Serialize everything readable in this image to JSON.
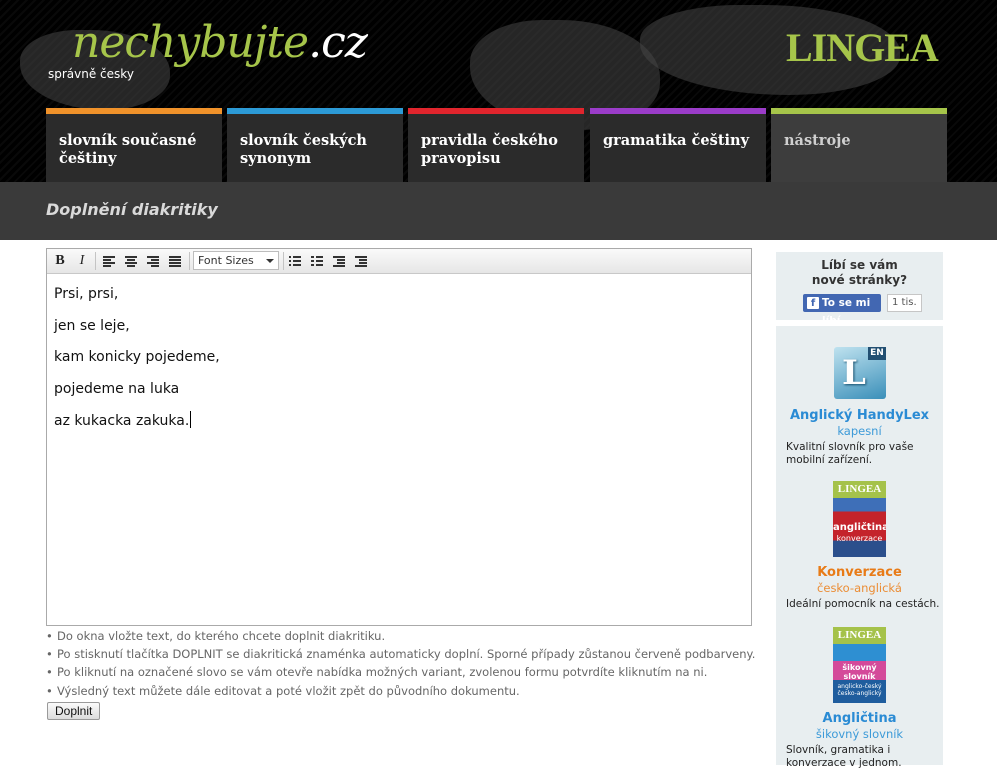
{
  "header": {
    "logo_name": "nechybujte",
    "logo_tld": ".cz",
    "tagline": "správně česky",
    "brand": "LINGEA"
  },
  "nav": [
    {
      "label": "slovník současné češtiny",
      "color": "#f0922a"
    },
    {
      "label": "slovník českých synonym",
      "color": "#2c9ad6"
    },
    {
      "label": "pravidla českého pravopisu",
      "color": "#e1252d"
    },
    {
      "label": "gramatika češtiny",
      "color": "#9b3cc9"
    },
    {
      "label": "nástroje",
      "color": "#a6c54a",
      "active": true
    }
  ],
  "page_title": "Doplnění diakritiky",
  "toolbar": {
    "bold": "B",
    "italic": "I",
    "font_sizes": "Font Sizes"
  },
  "editor": {
    "lines": [
      "Prsi, prsi,",
      "jen se leje,",
      "kam konicky pojedeme,",
      "pojedeme na luka",
      "az kukacka zakuka."
    ]
  },
  "hints": [
    "Do okna vložte text, do kterého chcete doplnit diakritiku.",
    "Po stisknutí tlačítka DOPLNIT se diakritická znaménka automaticky doplní. Sporné případy zůstanou červeně podbarveny.",
    "Po kliknutí na označené slovo se vám otevře nabídka možných variant, zvolenou formu potvrdíte kliknutím na ni.",
    "Výsledný text můžete dále editovat a poté vložit zpět do původního dokumentu."
  ],
  "button_doplnit": "Doplnit",
  "sidebar": {
    "fb_question_1": "Líbí se vám",
    "fb_question_2": "nové stránky?",
    "fb_like": "To se mi líbí",
    "fb_count": "1 tis.",
    "products": [
      {
        "name": "Anglický HandyLex",
        "sub": "kapesní",
        "desc": "Kvalitní slovník pro vaše mobilní zařízení.",
        "icon_badge": "EN"
      },
      {
        "name": "Konverzace",
        "sub": "česko-anglická",
        "desc": "Ideální pomocník na cestách.",
        "cover_brand": "LINGEA",
        "cover_title": "angličtina",
        "cover_sub": "konverzace"
      },
      {
        "name": "Angličtina",
        "sub": "šikovný slovník",
        "desc": "Slovník, gramatika i konverzace v jednom.",
        "cover_brand": "LINGEA",
        "cover_title": "šikovný slovník",
        "cover_sub": "anglicko-český česko-anglický"
      }
    ]
  },
  "colors": {
    "accent_green": "#a6c54a",
    "product_blue": "#2a8bd4",
    "product_orange": "#e87b17",
    "sidebar_bg": "#e8eef0"
  }
}
